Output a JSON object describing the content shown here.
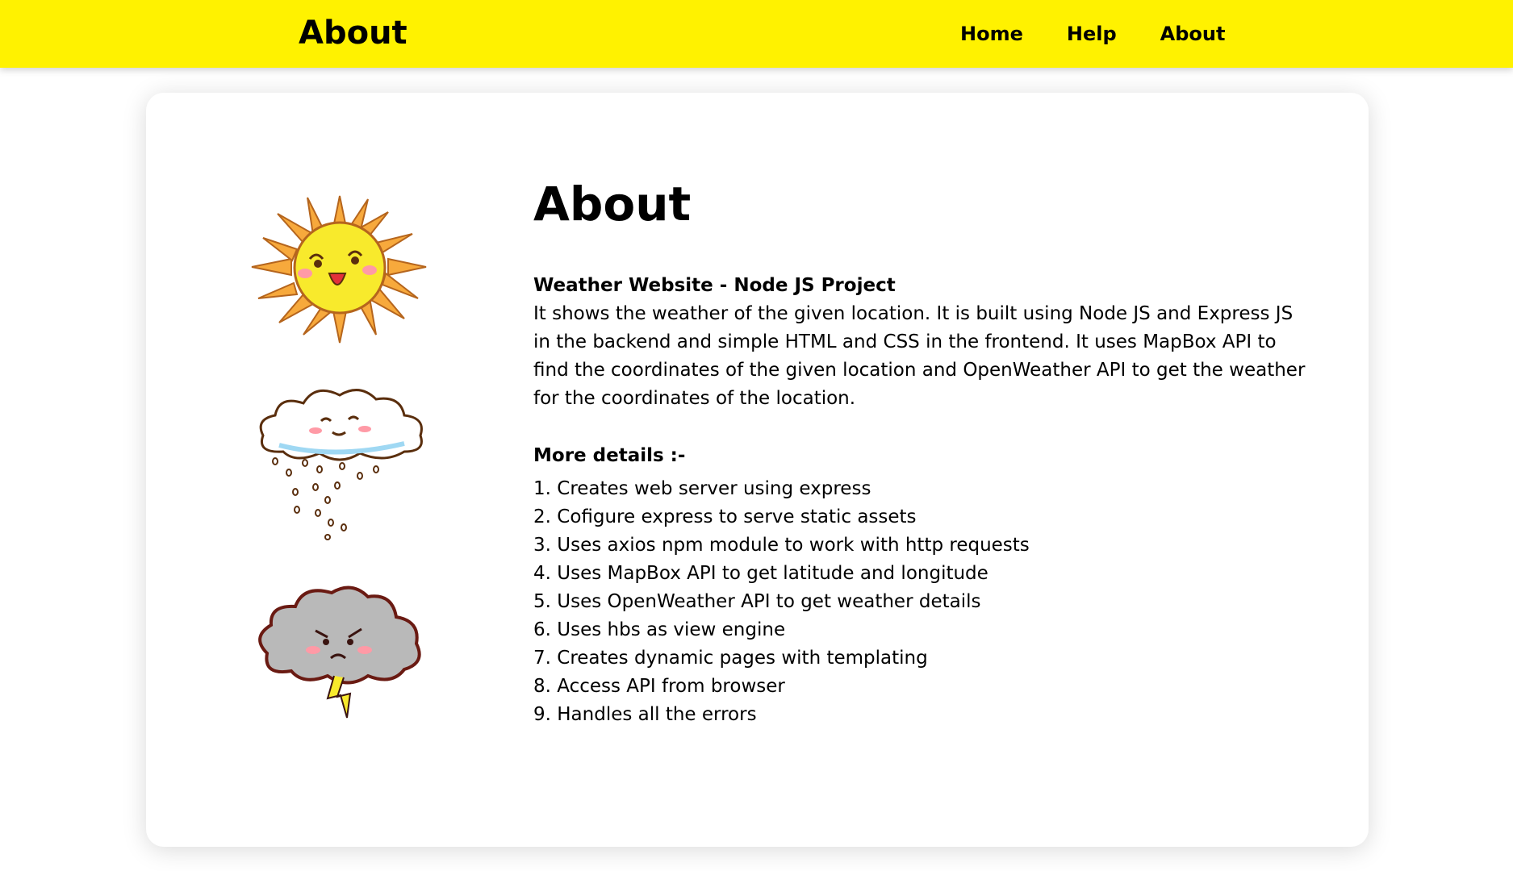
{
  "header": {
    "title": "About",
    "nav": [
      "Home",
      "Help",
      "About"
    ]
  },
  "main": {
    "title": "About",
    "project_title": "Weather Website - Node JS Project",
    "description": "It shows the weather of the given location. It is built using Node JS and Express JS in the backend and simple HTML and CSS in the frontend. It uses MapBox API to find the coordinates of the given location and OpenWeather API to get the weather for the coordinates of the location.",
    "details_title": "More details :-",
    "details": [
      "1. Creates web server using express",
      "2. Cofigure express to serve static assets",
      "3. Uses axios npm module to work with http requests",
      "4. Uses MapBox API to get latitude and longitude",
      "5. Uses OpenWeather API to get weather details",
      "6. Uses hbs as view engine",
      "7. Creates dynamic pages with templating",
      "8. Access API from browser",
      "9. Handles all the errors"
    ]
  },
  "illustrations": [
    "sun-icon",
    "snow-cloud-icon",
    "storm-cloud-icon"
  ],
  "colors": {
    "header_bg": "#fff200",
    "page_bg": "#ffffff",
    "text": "#000000"
  }
}
